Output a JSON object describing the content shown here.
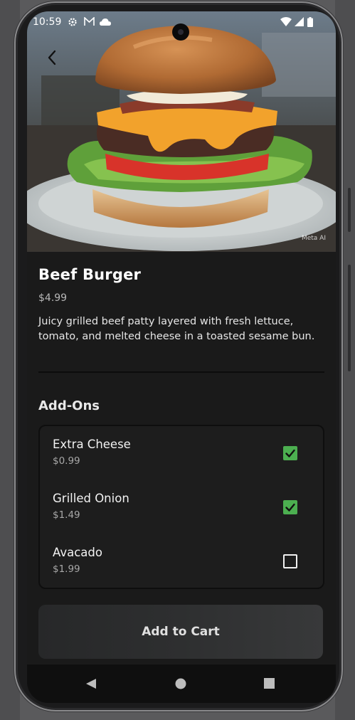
{
  "status_bar": {
    "time": "10:59"
  },
  "hero": {
    "watermark": "Meta AI"
  },
  "product": {
    "name": "Beef Burger",
    "price": "$4.99",
    "description": "Juicy grilled beef patty layered with fresh lettuce, tomato, and melted cheese in a toasted sesame bun."
  },
  "addons": {
    "title": "Add-Ons",
    "items": [
      {
        "name": "Extra Cheese",
        "price": "$0.99",
        "checked": true
      },
      {
        "name": "Grilled Onion",
        "price": "$1.49",
        "checked": true
      },
      {
        "name": "Avacado",
        "price": "$1.99",
        "checked": false
      }
    ]
  },
  "cart_button": {
    "label": "Add to Cart"
  },
  "colors": {
    "background": "#1a1a1a",
    "checkbox_checked": "#4caf50",
    "secondary_text": "#a8a8a8"
  },
  "icons": {
    "back": "arrow-back-icon",
    "nav": [
      "back-triangle-icon",
      "home-circle-icon",
      "recents-square-icon"
    ]
  }
}
